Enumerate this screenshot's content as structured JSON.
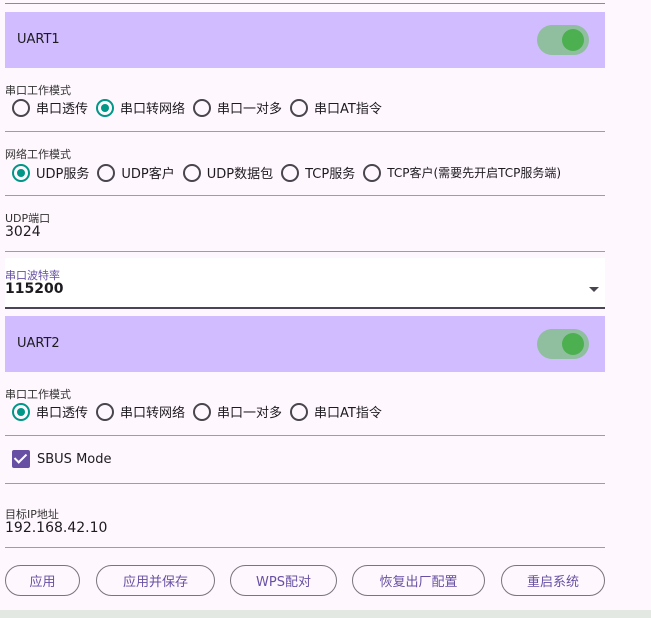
{
  "uart1": {
    "title": "UART1",
    "enabled": true,
    "serial_mode": {
      "label": "串口工作模式",
      "options": [
        "串口透传",
        "串口转网络",
        "串口一对多",
        "串口AT指令"
      ],
      "selected": 1
    },
    "network_mode": {
      "label": "网络工作模式",
      "options": [
        "UDP服务",
        "UDP客户",
        "UDP数据包",
        "TCP服务",
        "TCP客户(需要先开启TCP服务端)"
      ],
      "selected": 0
    },
    "udp_port": {
      "label": "UDP端口",
      "value": "3024"
    },
    "baud_rate": {
      "label": "串口波特率",
      "value": "115200"
    }
  },
  "uart2": {
    "title": "UART2",
    "enabled": true,
    "serial_mode": {
      "label": "串口工作模式",
      "options": [
        "串口透传",
        "串口转网络",
        "串口一对多",
        "串口AT指令"
      ],
      "selected": 0
    },
    "sbus": {
      "label": "SBUS Mode",
      "checked": true
    },
    "target_ip": {
      "label": "目标IP地址",
      "value": "192.168.42.10"
    }
  },
  "buttons": {
    "apply": "应用",
    "apply_save": "应用并保存",
    "wps": "WPS配对",
    "factory_reset": "恢复出厂配置",
    "reboot": "重启系统"
  },
  "colors": {
    "header_bg": "#d0bcff",
    "accent": "#6750a4",
    "radio_selected": "#009688",
    "switch_track": "#8fbf9e",
    "switch_knob": "#4caf50"
  }
}
